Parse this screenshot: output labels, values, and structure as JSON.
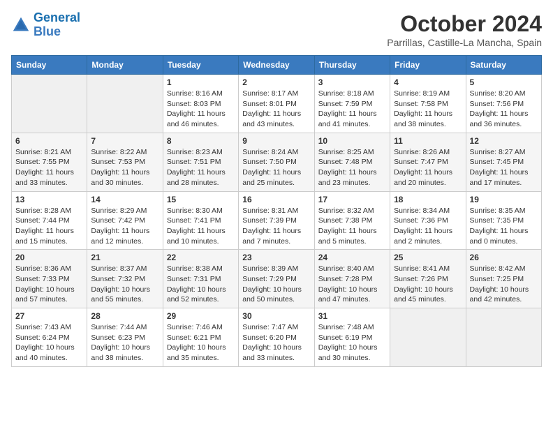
{
  "header": {
    "logo_line1": "General",
    "logo_line2": "Blue",
    "month": "October 2024",
    "location": "Parrillas, Castille-La Mancha, Spain"
  },
  "days_of_week": [
    "Sunday",
    "Monday",
    "Tuesday",
    "Wednesday",
    "Thursday",
    "Friday",
    "Saturday"
  ],
  "weeks": [
    [
      {
        "day": "",
        "info": ""
      },
      {
        "day": "",
        "info": ""
      },
      {
        "day": "1",
        "info": "Sunrise: 8:16 AM\nSunset: 8:03 PM\nDaylight: 11 hours and 46 minutes."
      },
      {
        "day": "2",
        "info": "Sunrise: 8:17 AM\nSunset: 8:01 PM\nDaylight: 11 hours and 43 minutes."
      },
      {
        "day": "3",
        "info": "Sunrise: 8:18 AM\nSunset: 7:59 PM\nDaylight: 11 hours and 41 minutes."
      },
      {
        "day": "4",
        "info": "Sunrise: 8:19 AM\nSunset: 7:58 PM\nDaylight: 11 hours and 38 minutes."
      },
      {
        "day": "5",
        "info": "Sunrise: 8:20 AM\nSunset: 7:56 PM\nDaylight: 11 hours and 36 minutes."
      }
    ],
    [
      {
        "day": "6",
        "info": "Sunrise: 8:21 AM\nSunset: 7:55 PM\nDaylight: 11 hours and 33 minutes."
      },
      {
        "day": "7",
        "info": "Sunrise: 8:22 AM\nSunset: 7:53 PM\nDaylight: 11 hours and 30 minutes."
      },
      {
        "day": "8",
        "info": "Sunrise: 8:23 AM\nSunset: 7:51 PM\nDaylight: 11 hours and 28 minutes."
      },
      {
        "day": "9",
        "info": "Sunrise: 8:24 AM\nSunset: 7:50 PM\nDaylight: 11 hours and 25 minutes."
      },
      {
        "day": "10",
        "info": "Sunrise: 8:25 AM\nSunset: 7:48 PM\nDaylight: 11 hours and 23 minutes."
      },
      {
        "day": "11",
        "info": "Sunrise: 8:26 AM\nSunset: 7:47 PM\nDaylight: 11 hours and 20 minutes."
      },
      {
        "day": "12",
        "info": "Sunrise: 8:27 AM\nSunset: 7:45 PM\nDaylight: 11 hours and 17 minutes."
      }
    ],
    [
      {
        "day": "13",
        "info": "Sunrise: 8:28 AM\nSunset: 7:44 PM\nDaylight: 11 hours and 15 minutes."
      },
      {
        "day": "14",
        "info": "Sunrise: 8:29 AM\nSunset: 7:42 PM\nDaylight: 11 hours and 12 minutes."
      },
      {
        "day": "15",
        "info": "Sunrise: 8:30 AM\nSunset: 7:41 PM\nDaylight: 11 hours and 10 minutes."
      },
      {
        "day": "16",
        "info": "Sunrise: 8:31 AM\nSunset: 7:39 PM\nDaylight: 11 hours and 7 minutes."
      },
      {
        "day": "17",
        "info": "Sunrise: 8:32 AM\nSunset: 7:38 PM\nDaylight: 11 hours and 5 minutes."
      },
      {
        "day": "18",
        "info": "Sunrise: 8:34 AM\nSunset: 7:36 PM\nDaylight: 11 hours and 2 minutes."
      },
      {
        "day": "19",
        "info": "Sunrise: 8:35 AM\nSunset: 7:35 PM\nDaylight: 11 hours and 0 minutes."
      }
    ],
    [
      {
        "day": "20",
        "info": "Sunrise: 8:36 AM\nSunset: 7:33 PM\nDaylight: 10 hours and 57 minutes."
      },
      {
        "day": "21",
        "info": "Sunrise: 8:37 AM\nSunset: 7:32 PM\nDaylight: 10 hours and 55 minutes."
      },
      {
        "day": "22",
        "info": "Sunrise: 8:38 AM\nSunset: 7:31 PM\nDaylight: 10 hours and 52 minutes."
      },
      {
        "day": "23",
        "info": "Sunrise: 8:39 AM\nSunset: 7:29 PM\nDaylight: 10 hours and 50 minutes."
      },
      {
        "day": "24",
        "info": "Sunrise: 8:40 AM\nSunset: 7:28 PM\nDaylight: 10 hours and 47 minutes."
      },
      {
        "day": "25",
        "info": "Sunrise: 8:41 AM\nSunset: 7:26 PM\nDaylight: 10 hours and 45 minutes."
      },
      {
        "day": "26",
        "info": "Sunrise: 8:42 AM\nSunset: 7:25 PM\nDaylight: 10 hours and 42 minutes."
      }
    ],
    [
      {
        "day": "27",
        "info": "Sunrise: 7:43 AM\nSunset: 6:24 PM\nDaylight: 10 hours and 40 minutes."
      },
      {
        "day": "28",
        "info": "Sunrise: 7:44 AM\nSunset: 6:23 PM\nDaylight: 10 hours and 38 minutes."
      },
      {
        "day": "29",
        "info": "Sunrise: 7:46 AM\nSunset: 6:21 PM\nDaylight: 10 hours and 35 minutes."
      },
      {
        "day": "30",
        "info": "Sunrise: 7:47 AM\nSunset: 6:20 PM\nDaylight: 10 hours and 33 minutes."
      },
      {
        "day": "31",
        "info": "Sunrise: 7:48 AM\nSunset: 6:19 PM\nDaylight: 10 hours and 30 minutes."
      },
      {
        "day": "",
        "info": ""
      },
      {
        "day": "",
        "info": ""
      }
    ]
  ]
}
